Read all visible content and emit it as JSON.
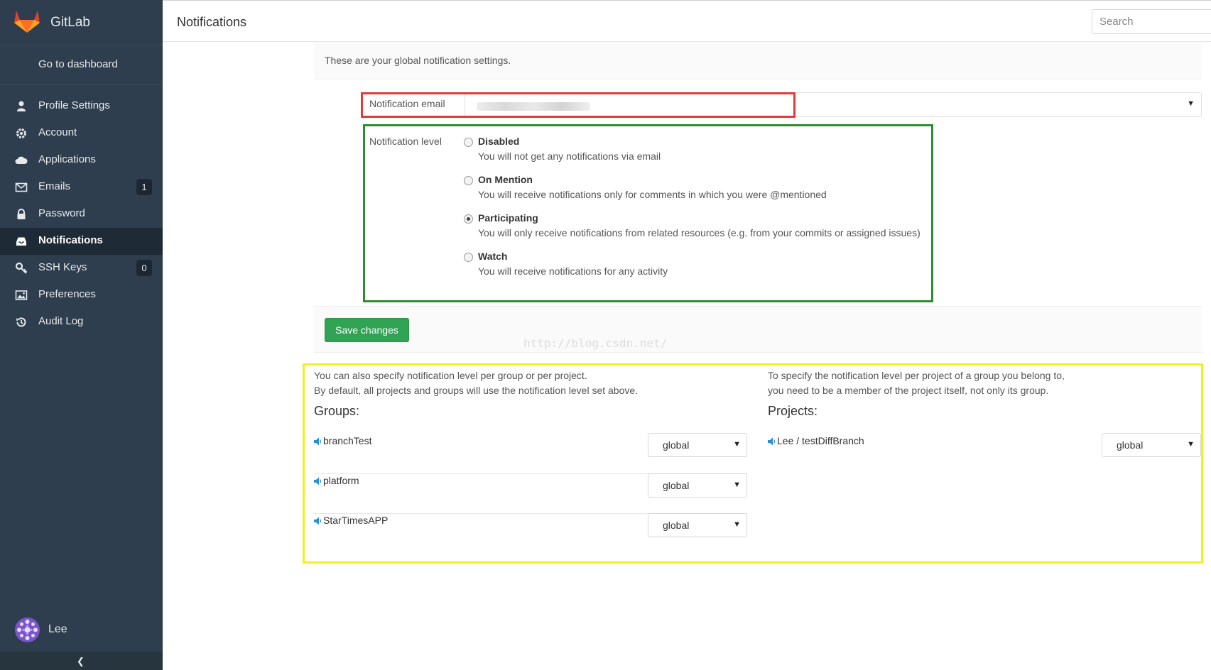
{
  "app": {
    "name": "GitLab"
  },
  "sidebar": {
    "dashboard_label": "Go to dashboard",
    "items": [
      {
        "label": "Profile Settings",
        "icon": "user-icon"
      },
      {
        "label": "Account",
        "icon": "gear-icon"
      },
      {
        "label": "Applications",
        "icon": "cloud-icon"
      },
      {
        "label": "Emails",
        "icon": "envelope-icon",
        "badge": "1"
      },
      {
        "label": "Password",
        "icon": "lock-icon"
      },
      {
        "label": "Notifications",
        "icon": "inbox-icon",
        "active": true
      },
      {
        "label": "SSH Keys",
        "icon": "key-icon",
        "badge": "0"
      },
      {
        "label": "Preferences",
        "icon": "image-icon"
      },
      {
        "label": "Audit Log",
        "icon": "history-icon"
      }
    ],
    "user": {
      "name": "Lee"
    },
    "collapse_icon": "chevron-left-icon"
  },
  "header": {
    "title": "Notifications",
    "search_placeholder": "Search"
  },
  "notifications": {
    "info_text": "These are your global notification settings.",
    "email_label": "Notification email",
    "level_label": "Notification level",
    "options": [
      {
        "title": "Disabled",
        "desc": "You will not get any notifications via email",
        "checked": false
      },
      {
        "title": "On Mention",
        "desc": "You will receive notifications only for comments in which you were @mentioned",
        "checked": false
      },
      {
        "title": "Participating",
        "desc": "You will only receive notifications from related resources (e.g. from your commits or assigned issues)",
        "checked": true
      },
      {
        "title": "Watch",
        "desc": "You will receive notifications for any activity",
        "checked": false
      }
    ],
    "save_label": "Save changes",
    "watermark": "http://blog.csdn.net/"
  },
  "scopes": {
    "groups_intro_1": "You can also specify notification level per group or per project.",
    "groups_intro_2": "By default, all projects and groups will use the notification level set above.",
    "groups_heading": "Groups:",
    "groups": [
      {
        "name": "branchTest",
        "level": "global"
      },
      {
        "name": "platform",
        "level": "global"
      },
      {
        "name": "StarTimesAPP",
        "level": "global"
      }
    ],
    "projects_intro_1": "To specify the notification level per project of a group you belong to,",
    "projects_intro_2": "you need to be a member of the project itself, not only its group.",
    "projects_heading": "Projects:",
    "projects": [
      {
        "name": "Lee / testDiffBranch",
        "level": "global"
      }
    ]
  },
  "colors": {
    "sidebar_bg": "#2e3e4e",
    "save_button": "#31a354",
    "annotation_red": "#e53935",
    "annotation_green": "#2e8b2e",
    "annotation_yellow": "#f5ee1f"
  }
}
